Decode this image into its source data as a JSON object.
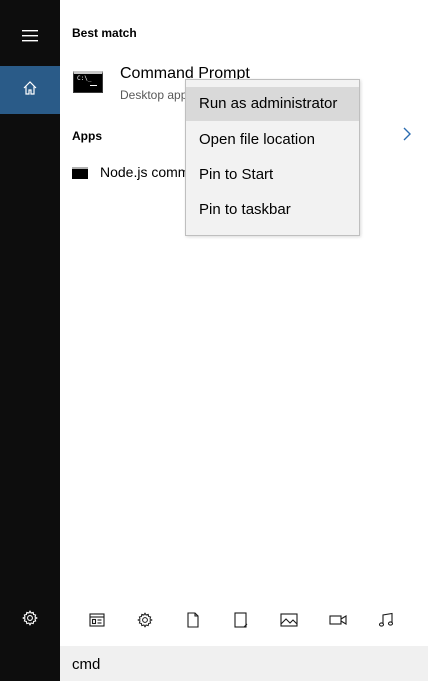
{
  "rail": {
    "items": [
      {
        "name": "hamburger-menu",
        "icon": "hamburger-icon"
      },
      {
        "name": "home",
        "icon": "home-icon",
        "active": true
      },
      {
        "name": "settings",
        "icon": "gear-icon"
      }
    ],
    "background": "#0d0d0d",
    "accent": "#2a5b88"
  },
  "best_match": {
    "header": "Best match",
    "item": {
      "title": "Command Prompt",
      "subtitle": "Desktop app",
      "icon": "command-prompt-icon"
    }
  },
  "apps": {
    "header": "Apps",
    "chevron_icon": "chevron-right-icon",
    "items": [
      {
        "label": "Node.js command prompt",
        "icon": "console-icon"
      }
    ]
  },
  "context_menu": {
    "items": [
      {
        "label": "Run as administrator",
        "highlighted": true
      },
      {
        "label": "Open file location",
        "highlighted": false
      },
      {
        "label": "Pin to Start",
        "highlighted": false
      },
      {
        "label": "Pin to taskbar",
        "highlighted": false
      }
    ]
  },
  "filters": [
    {
      "icon": "apps-filter-icon"
    },
    {
      "icon": "settings-filter-icon"
    },
    {
      "icon": "documents-filter-icon"
    },
    {
      "icon": "folders-filter-icon"
    },
    {
      "icon": "photos-filter-icon"
    },
    {
      "icon": "videos-filter-icon"
    },
    {
      "icon": "music-filter-icon"
    }
  ],
  "search": {
    "value": "cmd"
  }
}
